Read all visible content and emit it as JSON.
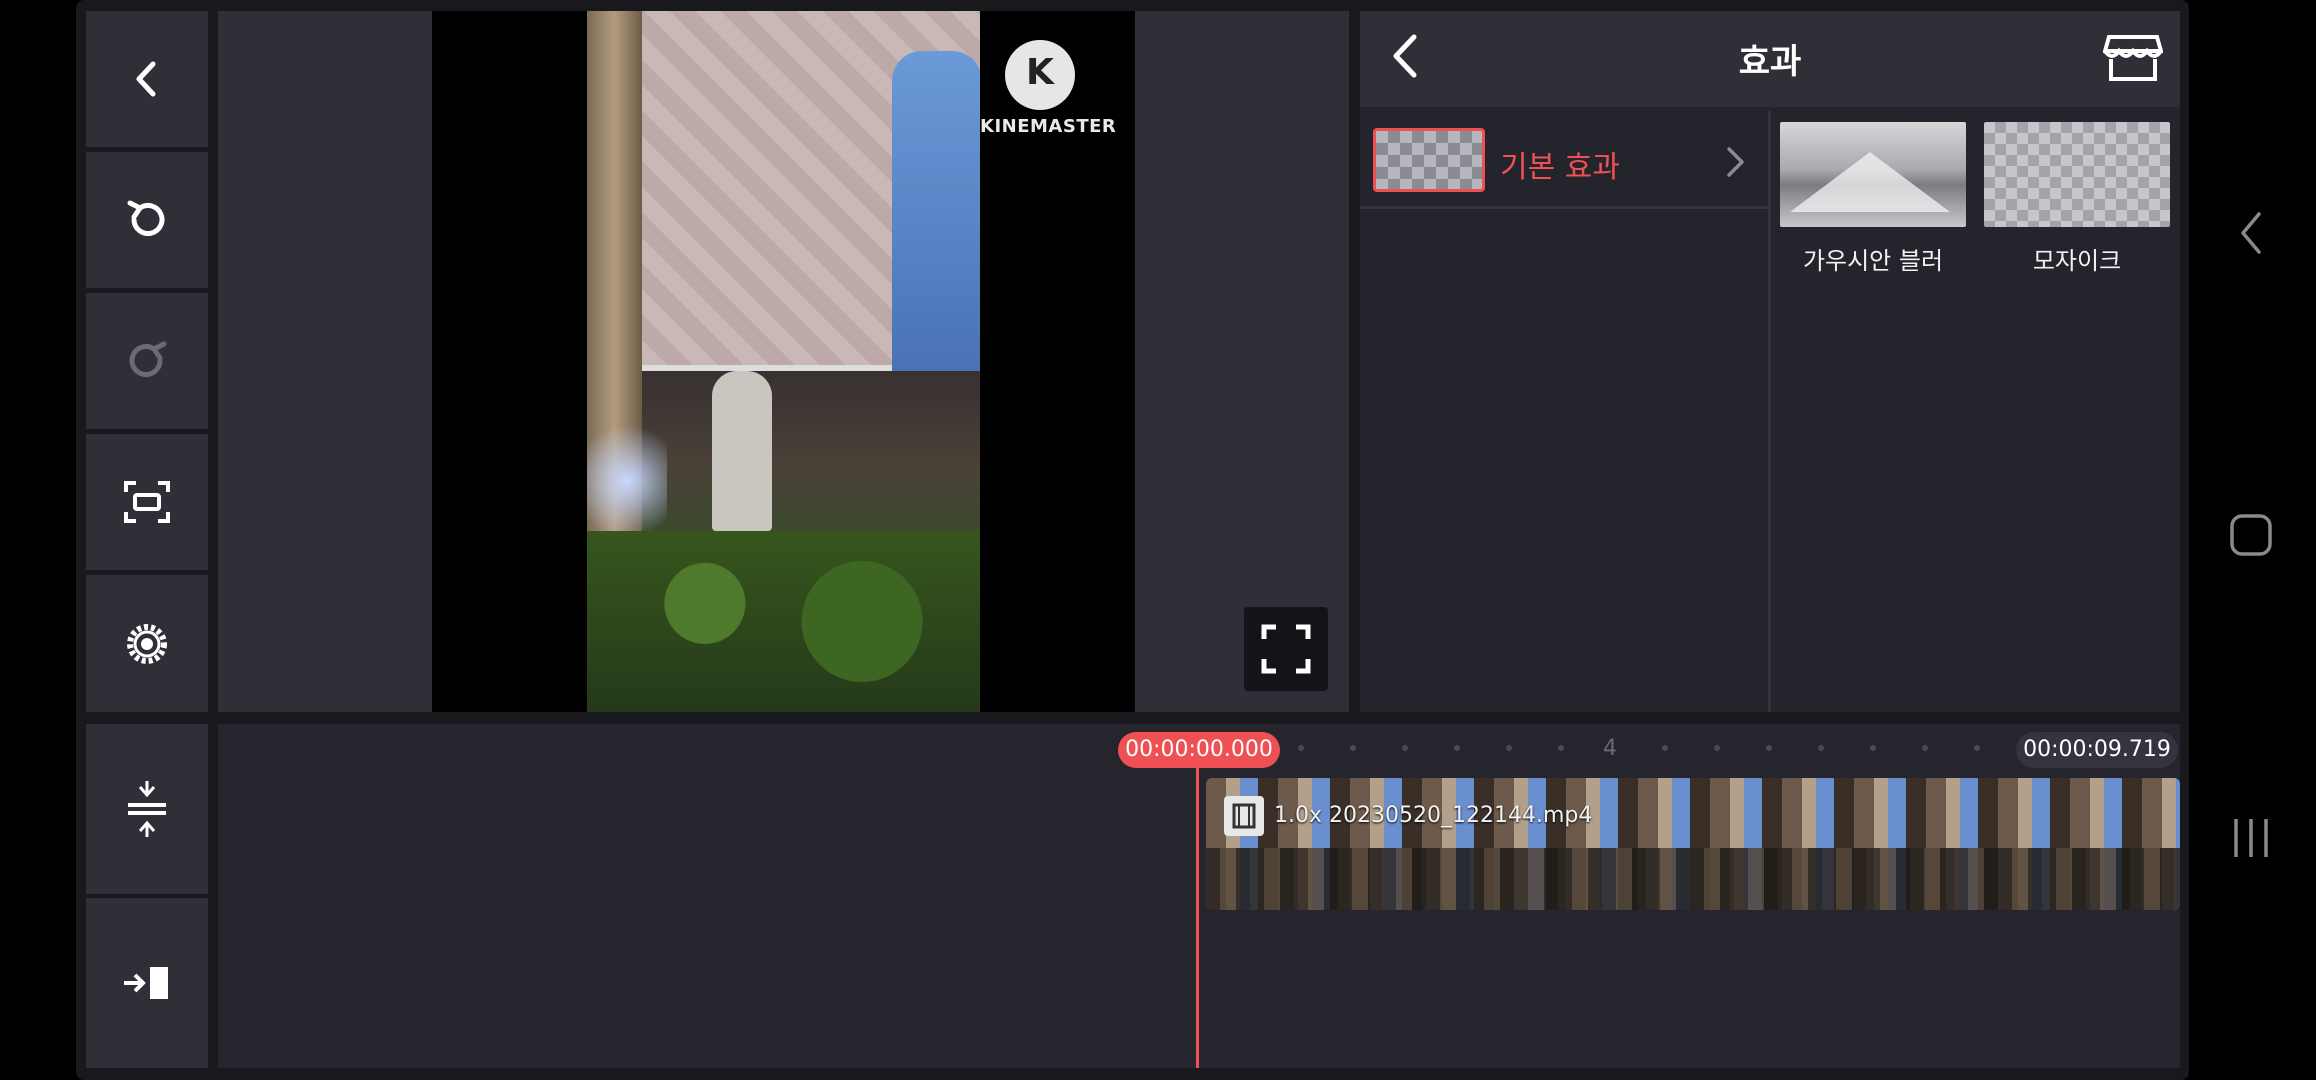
{
  "toolbar": {
    "back": "back-icon",
    "undo": "undo-icon",
    "redo": "redo-icon",
    "capture": "capture-icon",
    "settings": "settings-icon",
    "layers": "layer-adjust-icon",
    "export": "export-icon"
  },
  "watermark": {
    "letter": "K",
    "text": "KINEMASTER"
  },
  "panel": {
    "title": "효과",
    "category_label": "기본 효과",
    "effects": [
      {
        "label": "가우시안 블러"
      },
      {
        "label": "모자이크"
      }
    ]
  },
  "timeline": {
    "playhead_time": "00:00:00.000",
    "end_time": "00:00:09.719",
    "ruler_mark": "4",
    "clip_name": "1.0x 20230520_122144.mp4"
  },
  "colors": {
    "accent": "#ef5054",
    "panel": "#2f2f38",
    "background": "#18181d"
  }
}
